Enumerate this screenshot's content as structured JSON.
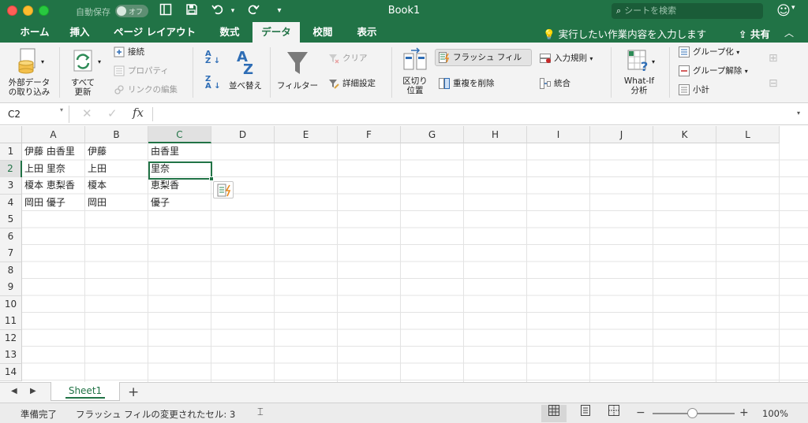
{
  "titlebar": {
    "autosave_label": "自動保存",
    "autosave_state": "オフ",
    "doc_title": "Book1",
    "search_placeholder": "シートを検索"
  },
  "tabs": [
    {
      "label": "ホーム",
      "active": false
    },
    {
      "label": "挿入",
      "active": false
    },
    {
      "label": "ページ レイアウト",
      "active": false
    },
    {
      "label": "数式",
      "active": false
    },
    {
      "label": "データ",
      "active": true
    },
    {
      "label": "校閲",
      "active": false
    },
    {
      "label": "表示",
      "active": false
    }
  ],
  "tellme": "実行したい作業内容を入力します",
  "share_label": "共有",
  "ribbon": {
    "external_data": "外部データ\nの取り込み",
    "refresh_all": "すべて\n更新",
    "connections": "接続",
    "properties": "プロパティ",
    "edit_links": "リンクの編集",
    "sort": "並べ替え",
    "filter": "フィルター",
    "clear": "クリア",
    "advanced": "詳細設定",
    "text_to_columns": "区切り\n位置",
    "flash_fill": "フラッシュ フィル",
    "remove_duplicates": "重複を削除",
    "data_validation": "入力規則",
    "consolidate": "統合",
    "what_if": "What-If\n分析",
    "group": "グループ化",
    "ungroup": "グループ解除",
    "subtotal": "小計"
  },
  "formula_bar": {
    "name_box": "C2",
    "fx": "fx",
    "content": ""
  },
  "columns": [
    "A",
    "B",
    "C",
    "D",
    "E",
    "F",
    "G",
    "H",
    "I",
    "J",
    "K",
    "L"
  ],
  "selected_column": "C",
  "rows": [
    "1",
    "2",
    "3",
    "4",
    "5",
    "6",
    "7",
    "8",
    "9",
    "10",
    "11",
    "12",
    "13",
    "14"
  ],
  "selected_row": "2",
  "cells": {
    "A1": "伊藤 由香里",
    "B1": "伊藤",
    "C1": "由香里",
    "A2": "上田 里奈",
    "B2": "上田",
    "C2": "里奈",
    "A3": "榎本 恵梨香",
    "B3": "榎本",
    "C3": "恵梨香",
    "A4": "岡田 優子",
    "B4": "岡田",
    "C4": "優子"
  },
  "sheets": [
    {
      "label": "Sheet1",
      "active": true
    }
  ],
  "status": {
    "ready": "準備完了",
    "message": "フラッシュ フィルの変更されたセル: 3",
    "zoom": "100%"
  },
  "colors": {
    "accent": "#217346",
    "selection": "#217346"
  }
}
